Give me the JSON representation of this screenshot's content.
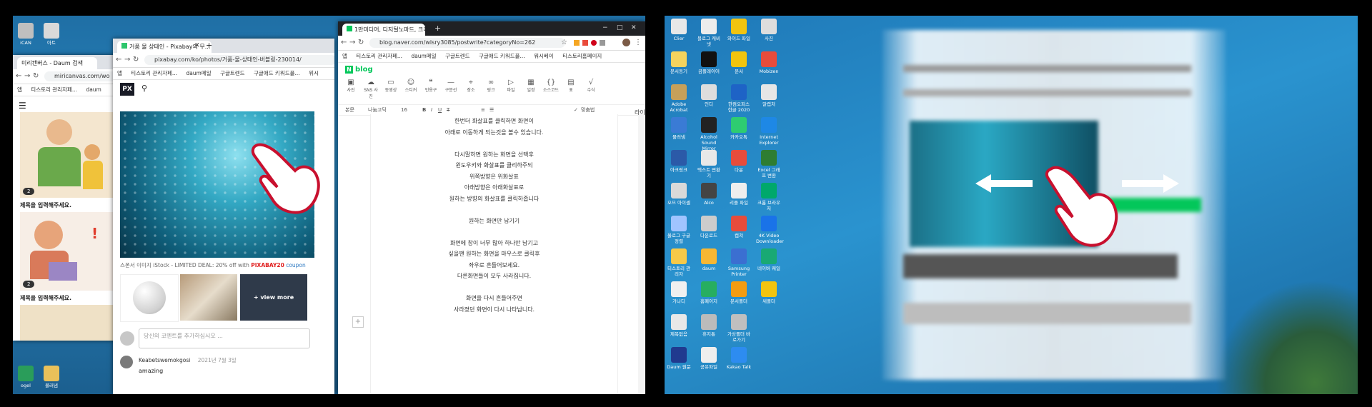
{
  "left": {
    "daum_window": {
      "tab_title": "미리캔버스 - Daum 검색",
      "address": "miricanvas.com/wo",
      "bookmarks": [
        "앱",
        "티스토리 관리자페...",
        "daum"
      ],
      "cards": [
        {
          "badge": "2",
          "title": "제목을 입력해주세요."
        },
        {
          "badge": "2",
          "title": "제목을 입력해주세요."
        }
      ]
    },
    "pixabay_window": {
      "tab_title": "거품 물 상태인 - Pixabay의 무...",
      "address": "pixabay.com/ko/photos/거품-물-상태인-버블링-230014/",
      "bookmarks": [
        "앱",
        "티스토리 관리자페...",
        "daum메일",
        "구글트렌드",
        "구글애드 키워드플...",
        "위시"
      ],
      "logo": "PX",
      "sponsor": "스폰서 이미지 iStock - LIMITED DEAL: 20% off with",
      "coupon_code": "PIXABAY20",
      "coupon_word": "coupon",
      "view_more": "+ view more",
      "comment_placeholder": "당신의 코멘트를 추가하십시오 ...",
      "commenter": "Keabetswemokgosi",
      "comment_date": "2021년 7월 3일",
      "comment_text": "amazing"
    },
    "blog_window": {
      "tab_title": "1만미디어, 디지털노마드, 크리...",
      "address": "blog.naver.com/wlsry3085/postwrite?categoryNo=262",
      "bookmarks": [
        "앱",
        "티스토리 관리자페...",
        "daum메일",
        "구글트렌드",
        "구글애드 키워드플...",
        "워시베이",
        "티스토리홈페이지"
      ],
      "brand": "blog",
      "tools": [
        "사진",
        "SNS 사진",
        "동영상",
        "스티커",
        "인용구",
        "구분선",
        "장소",
        "링크",
        "파일",
        "일정",
        "소스코드",
        "표",
        "수식"
      ],
      "format": {
        "style": "본문",
        "font": "나눔고딕",
        "size": "16",
        "align_word": "맞춤법"
      },
      "lines": [
        "한번더 화살표를 클릭하면 화면이",
        "아래로 이동하게 되는것을 볼수 있습니다.",
        "",
        "다시말하면 원하는 화면을 선택후",
        "윈도우키와 화살표를 클리하주되",
        "위쪽방향은 위화살표",
        "아래방향은 아래화살표로",
        "원하는 방향의 화살표를 클릭하줍니다",
        "",
        "원하는 화면만 남기기",
        "",
        "화면에 창이 너무 많아 하나만 남기고",
        "싶을땐 원하는 화면을 마우스로 클릭후",
        "좌우로 흔들어보세요.",
        "다른화면들이 모두 사라집니다.",
        "",
        "화면을 다시 흔들어주면",
        "사라졌던 화면이 다시 나타납니다."
      ],
      "side_label": "라이"
    },
    "taskbar_icons": [
      {
        "label": "ogel"
      },
      {
        "label": "불러냄"
      },
      {
        "label": "iCAN"
      },
      {
        "label": "아트"
      }
    ]
  },
  "right": {
    "desktop_icons": [
      {
        "label": "Clier"
      },
      {
        "label": "문서동기"
      },
      {
        "label": "Adobe Acrobat"
      },
      {
        "label": "물러냄"
      },
      {
        "label": "아크링크"
      },
      {
        "label": "오므 아이셀"
      },
      {
        "label": "올로그 구글정렬"
      },
      {
        "label": "티스토리 관리자"
      },
      {
        "label": "가나디"
      },
      {
        "label": "제목없음"
      },
      {
        "label": "Daum 원문"
      },
      {
        "label": "블로그 캐비넷"
      },
      {
        "label": "곰플레이어"
      },
      {
        "label": "인디"
      },
      {
        "label": "Alcohol Sound Mirror"
      },
      {
        "label": "텍스트 변환기"
      },
      {
        "label": "Alco"
      },
      {
        "label": "다운로드"
      },
      {
        "label": "daum"
      },
      {
        "label": "홈페이지"
      },
      {
        "label": "휴지통"
      },
      {
        "label": "공유파일"
      },
      {
        "label": "와이드 파일"
      },
      {
        "label": "문서"
      },
      {
        "label": "한컴오피스 한글 2020"
      },
      {
        "label": "카카오톡"
      },
      {
        "label": "다운"
      },
      {
        "label": "리플 파일"
      },
      {
        "label": "캡쳐"
      },
      {
        "label": "Samsung Printer"
      },
      {
        "label": "문서폴더"
      },
      {
        "label": "가상폴더 바로가기"
      },
      {
        "label": "Kakao Talk"
      },
      {
        "label": "사진"
      },
      {
        "label": "Mobizen"
      },
      {
        "label": "알캡처"
      },
      {
        "label": "Internet Explorer"
      },
      {
        "label": "Excel 그래프 변환"
      },
      {
        "label": "크롬 브라우저"
      },
      {
        "label": "4K Video Downloader"
      },
      {
        "label": "네이버 웨일"
      },
      {
        "label": "새폴더"
      }
    ]
  },
  "colors": {
    "naver_green": "#03c75a",
    "pixabay_red": "#e01e1e",
    "hand_outline": "#c8102e"
  }
}
